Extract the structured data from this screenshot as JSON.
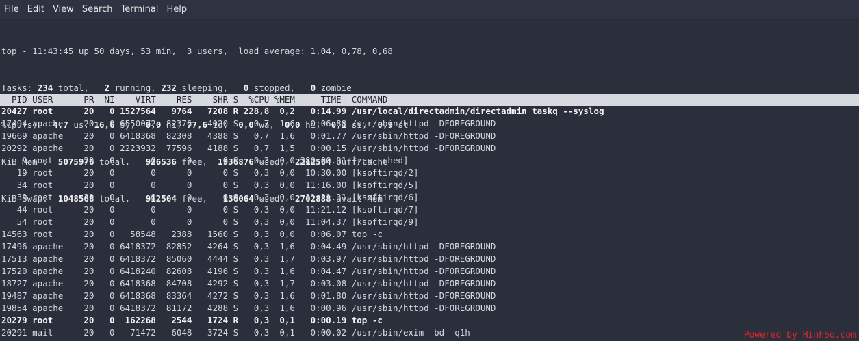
{
  "menubar": {
    "items": [
      "File",
      "Edit",
      "View",
      "Search",
      "Terminal",
      "Help"
    ]
  },
  "summary": {
    "uptime_line": "top - 11:43:45 up 50 days, 53 min,  3 users,  load average: 1,04, 0,78, 0,68",
    "tasks": {
      "label": "Tasks:",
      "total": "234",
      "running": "2",
      "sleeping": "232",
      "stopped": "0",
      "zombie": "0"
    },
    "cpu": {
      "label": "%Cpu(s):",
      "us": "4,7",
      "sy": "16,6",
      "ni": "0,0",
      "id": "77,6",
      "wa": "0,0",
      "hi": "0,0",
      "si": "0,1",
      "st": "0,9"
    },
    "mem": {
      "label": "KiB Mem :",
      "total": "5075976",
      "free": "926536",
      "used": "1936876",
      "buff_cache": "2212564"
    },
    "swap": {
      "label": "KiB Swap:",
      "total": "1048568",
      "free": "912504",
      "used": "136064",
      "avail_mem": "2702888"
    }
  },
  "table_header": "  PID USER      PR  NI    VIRT    RES    SHR S  %CPU %MEM     TIME+ COMMAND",
  "processes": [
    {
      "text": "20427 root      20   0 1527564   9764   7208 R 228,8  0,2   0:14.99 /usr/local/directadmin/directadmin taskq --syslog",
      "bold": true
    },
    {
      "text": "17494 apache    20   0 6550072  82376   4020 S   0,7  1,6   0:06.88 /usr/sbin/httpd -DFOREGROUND",
      "bold": false
    },
    {
      "text": "19669 apache    20   0 6418368  82308   4388 S   0,7  1,6   0:01.77 /usr/sbin/httpd -DFOREGROUND",
      "bold": false
    },
    {
      "text": "20292 apache    20   0 2223932  77596   4188 S   0,7  1,5   0:00.15 /usr/sbin/httpd -DFOREGROUND",
      "bold": false
    },
    {
      "text": "    9 root      20   0       0      0      0 S   0,3  0,0 380:00.91 [rcu_sched]",
      "bold": false
    },
    {
      "text": "   19 root      20   0       0      0      0 S   0,3  0,0  10:30.00 [ksoftirqd/2]",
      "bold": false
    },
    {
      "text": "   34 root      20   0       0      0      0 S   0,3  0,0  11:16.00 [ksoftirqd/5]",
      "bold": false
    },
    {
      "text": "   39 root      20   0       0      0      0 S   0,3  0,0  11:21.31 [ksoftirqd/6]",
      "bold": false
    },
    {
      "text": "   44 root      20   0       0      0      0 S   0,3  0,0  11:21.12 [ksoftirqd/7]",
      "bold": false
    },
    {
      "text": "   54 root      20   0       0      0      0 S   0,3  0,0  11:04.37 [ksoftirqd/9]",
      "bold": false
    },
    {
      "text": "14563 root      20   0   58548   2388   1560 S   0,3  0,0   0:06.07 top -c",
      "bold": false
    },
    {
      "text": "17496 apache    20   0 6418372  82852   4264 S   0,3  1,6   0:04.49 /usr/sbin/httpd -DFOREGROUND",
      "bold": false
    },
    {
      "text": "17513 apache    20   0 6418372  85060   4444 S   0,3  1,7   0:03.97 /usr/sbin/httpd -DFOREGROUND",
      "bold": false
    },
    {
      "text": "17520 apache    20   0 6418240  82608   4196 S   0,3  1,6   0:04.47 /usr/sbin/httpd -DFOREGROUND",
      "bold": false
    },
    {
      "text": "18727 apache    20   0 6418368  84708   4292 S   0,3  1,7   0:03.08 /usr/sbin/httpd -DFOREGROUND",
      "bold": false
    },
    {
      "text": "19487 apache    20   0 6418368  83364   4272 S   0,3  1,6   0:01.80 /usr/sbin/httpd -DFOREGROUND",
      "bold": false
    },
    {
      "text": "19854 apache    20   0 6418372  81172   4288 S   0,3  1,6   0:00.96 /usr/sbin/httpd -DFOREGROUND",
      "bold": false
    },
    {
      "text": "20279 root      20   0  162268   2544   1724 R   0,3  0,1   0:00.19 top -c",
      "bold": true
    },
    {
      "text": "20291 mail      20   0   71472   6048   3724 S   0,3  0,1   0:00.02 /usr/sbin/exim -bd -q1h",
      "bold": false
    }
  ],
  "watermark": "Powered by HinhSo.com",
  "colors": {
    "background": "#2b2e3b",
    "menubar": "#2f3241",
    "header_bar": "#d6d9df",
    "text": "#d3d7de",
    "watermark": "#e2262b"
  }
}
